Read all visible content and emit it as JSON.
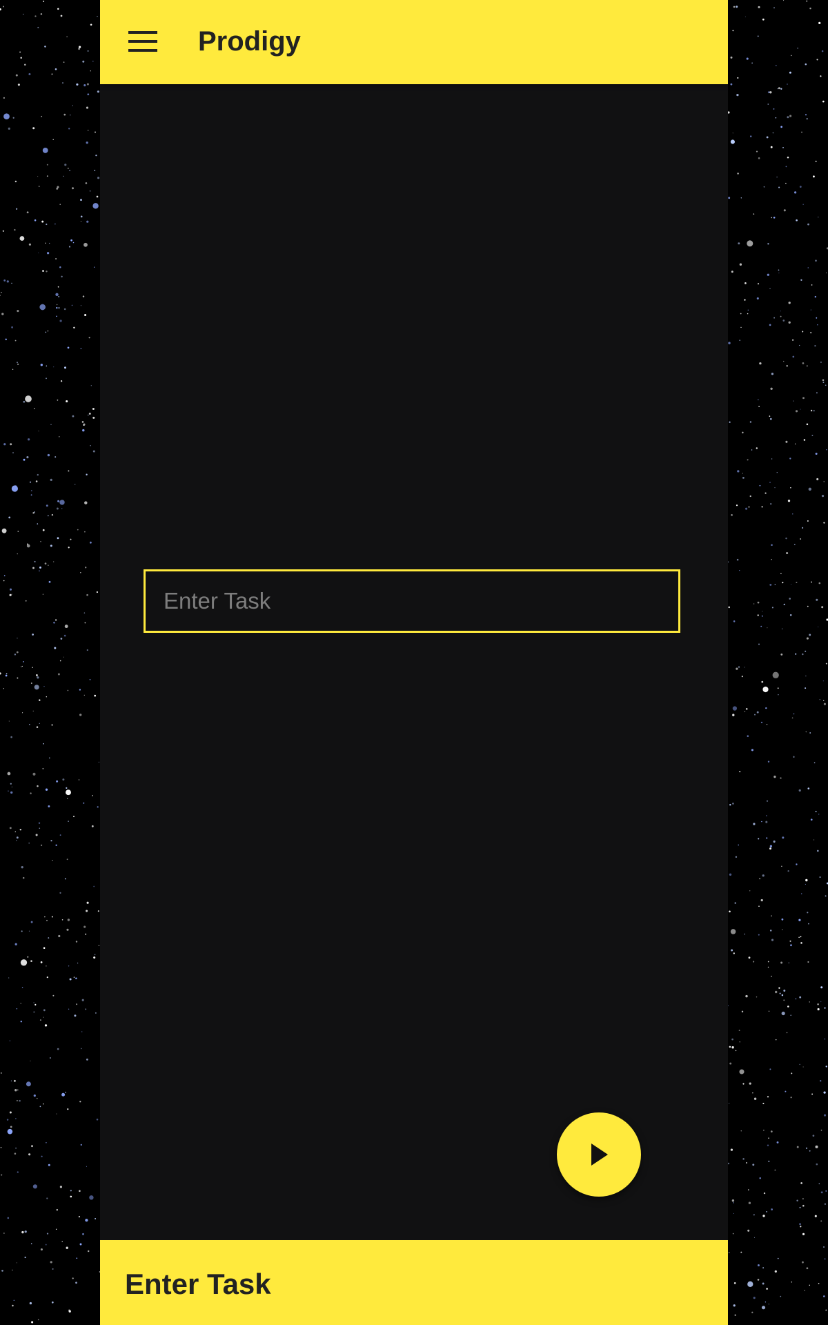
{
  "app": {
    "title": "Prodigy"
  },
  "icons": {
    "menu": "hamburger-menu-icon",
    "play": "play-icon"
  },
  "task_input": {
    "placeholder": "Enter Task",
    "value": ""
  },
  "bottom_bar": {
    "label": "Enter Task"
  },
  "colors": {
    "accent": "#ffea3d",
    "surface": "#111112",
    "background": "#000000",
    "text_dark": "#222222",
    "placeholder": "#7d7d7d"
  }
}
